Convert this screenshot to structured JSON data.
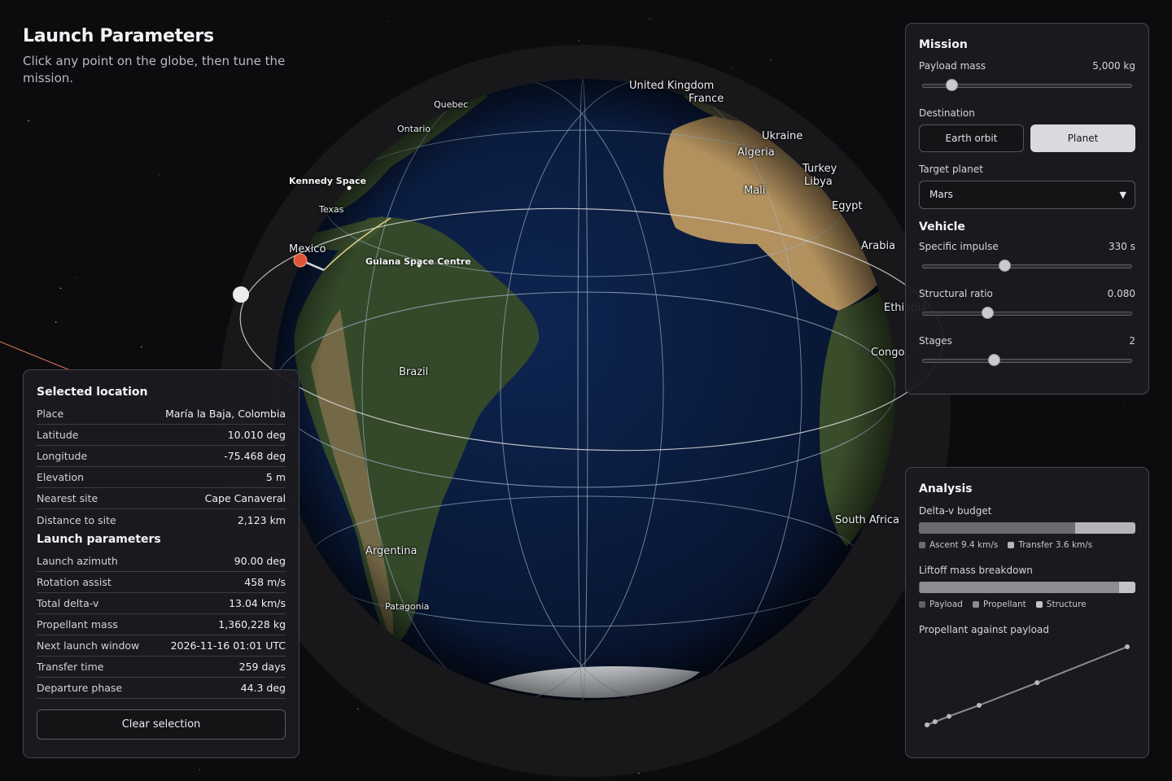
{
  "header": {
    "title": "Launch Parameters",
    "subtitle": "Click any point on the globe, then tune the mission."
  },
  "globe": {
    "labels": [
      "United Kingdom",
      "France",
      "Quebec",
      "Ontario",
      "Texas",
      "Mexico",
      "Ukraine",
      "Algeria",
      "Turkey",
      "Libya",
      "Egypt",
      "Mali",
      "Arabia",
      "Ethiopia",
      "Congo",
      "South Africa",
      "Brazil",
      "Argentina",
      "Patagonia"
    ],
    "sites": [
      "Kennedy Space",
      "Guiana Space Centre"
    ],
    "colors": {
      "ocean": "#0b1a3c",
      "land": "#3b4f2a",
      "desert": "#b3915e",
      "graticule": "#9fb6c8",
      "orbit": "#dcdcdc",
      "marker": "#e0553a"
    }
  },
  "mission": {
    "title": "Mission",
    "payload_label": "Payload mass",
    "payload_value": "5,000 kg",
    "payload_fraction": 0.14,
    "destination_label": "Destination",
    "destination_options": [
      "Earth orbit",
      "Planet"
    ],
    "destination_selected": "Planet",
    "target_label": "Target planet",
    "target_value": "Mars"
  },
  "vehicle": {
    "title": "Vehicle",
    "isp_label": "Specific impulse",
    "isp_value": "330 s",
    "isp_fraction": 0.39,
    "struct_label": "Structural ratio",
    "struct_value": "0.080",
    "struct_fraction": 0.31,
    "stages_label": "Stages",
    "stages_value": "2",
    "stages_fraction": 0.34
  },
  "selected": {
    "title": "Selected location",
    "rows": [
      {
        "k": "Place",
        "v": "María la Baja, Colombia"
      },
      {
        "k": "Latitude",
        "v": "10.010 deg"
      },
      {
        "k": "Longitude",
        "v": "-75.468 deg"
      },
      {
        "k": "Elevation",
        "v": "5 m"
      },
      {
        "k": "Nearest site",
        "v": "Cape Canaveral"
      },
      {
        "k": "Distance to site",
        "v": "2,123 km"
      }
    ],
    "launch_title": "Launch parameters",
    "launch_rows": [
      {
        "k": "Launch azimuth",
        "v": "90.00 deg"
      },
      {
        "k": "Rotation assist",
        "v": "458 m/s"
      },
      {
        "k": "Total delta-v",
        "v": "13.04 km/s"
      },
      {
        "k": "Propellant mass",
        "v": "1,360,228 kg"
      },
      {
        "k": "Next launch window",
        "v": "2026-11-16 01:01 UTC"
      },
      {
        "k": "Transfer time",
        "v": "259 days"
      },
      {
        "k": "Departure phase",
        "v": "44.3 deg"
      }
    ],
    "clear_label": "Clear selection"
  },
  "analysis": {
    "title": "Analysis",
    "dv_label": "Delta-v budget",
    "dv_legend": [
      "Ascent 9.4 km/s",
      "Transfer 3.6 km/s"
    ],
    "dv_values": [
      9.4,
      3.6
    ],
    "dv_colors": [
      "#6b6b70",
      "#b4b4b9"
    ],
    "mass_label": "Liftoff mass breakdown",
    "mass_legend": [
      "Payload",
      "Propellant",
      "Structure"
    ],
    "mass_colors": [
      "#5f5f64",
      "#8c8c91",
      "#c4c4c8"
    ],
    "curve_label": "Propellant against payload"
  },
  "chart_data": {
    "type": "line",
    "title": "Propellant against payload",
    "xlabel": "",
    "ylabel": "",
    "series": [
      {
        "values": [
          0.0,
          0.04,
          0.11,
          0.25,
          0.54,
          1.0
        ]
      }
    ],
    "x": [
      0.0,
      0.04,
      0.11,
      0.26,
      0.55,
      1.0
    ],
    "grid": false
  }
}
